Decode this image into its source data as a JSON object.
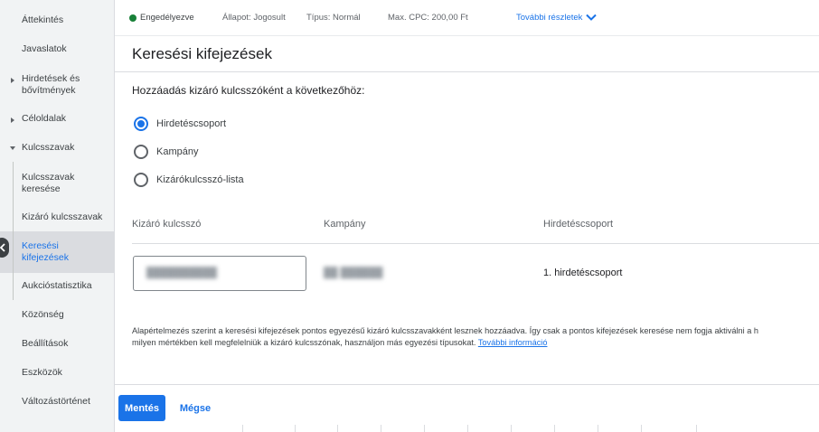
{
  "sidebar": {
    "items": [
      {
        "label": "Áttekintés"
      },
      {
        "label": "Javaslatok"
      },
      {
        "label": "Hirdetések és\nbővítmények"
      },
      {
        "label": "Céloldalak"
      },
      {
        "label": "Kulcsszavak"
      },
      {
        "label": "Kulcsszavak\nkeresése"
      },
      {
        "label": "Kizáró kulcsszavak"
      },
      {
        "label": "Keresési\nkifejezések"
      },
      {
        "label": "Aukcióstatisztika"
      },
      {
        "label": "Közönség"
      },
      {
        "label": "Beállítások"
      },
      {
        "label": "Eszközök"
      },
      {
        "label": "Változástörténet"
      }
    ],
    "active_index": 7
  },
  "status_bar": {
    "status": "Engedélyezve",
    "state": "Állapot: Jogosult",
    "type": "Típus: Normál",
    "max_cpc": "Max. CPC: 200,00 Ft",
    "more_details": "További részletek",
    "status_color": "#188038"
  },
  "page": {
    "title": "Keresési kifejezések"
  },
  "form": {
    "heading": "Hozzáadás kizáró kulcsszóként a következőhöz:",
    "options": [
      {
        "label": "Hirdetéscsoport",
        "selected": true
      },
      {
        "label": "Kampány",
        "selected": false
      },
      {
        "label": "Kizárókulcsszó-lista",
        "selected": false
      }
    ]
  },
  "table": {
    "headers": [
      "Kizáró kulcsszó",
      "Kampány",
      "Hirdetéscsoport"
    ],
    "rows": [
      {
        "adgroup": "1. hirdetéscsoport"
      }
    ]
  },
  "note": {
    "line1": "Alapértelmezés szerint a keresési kifejezések pontos egyezésű kizáró kulcsszavakként lesznek hozzáadva. Így csak a pontos kifejezések keresése nem fogja aktiválni a h",
    "line2": "milyen mértékben kell megfelelniük a kizáró kulcsszónak, használjon más egyezési típusokat.",
    "link": "További információ"
  },
  "footer": {
    "save": "Mentés",
    "cancel": "Mégse"
  },
  "colors": {
    "accent": "#1a73e8",
    "sidebar_bg": "#f1f3f4",
    "active_bg": "#dadce0"
  }
}
